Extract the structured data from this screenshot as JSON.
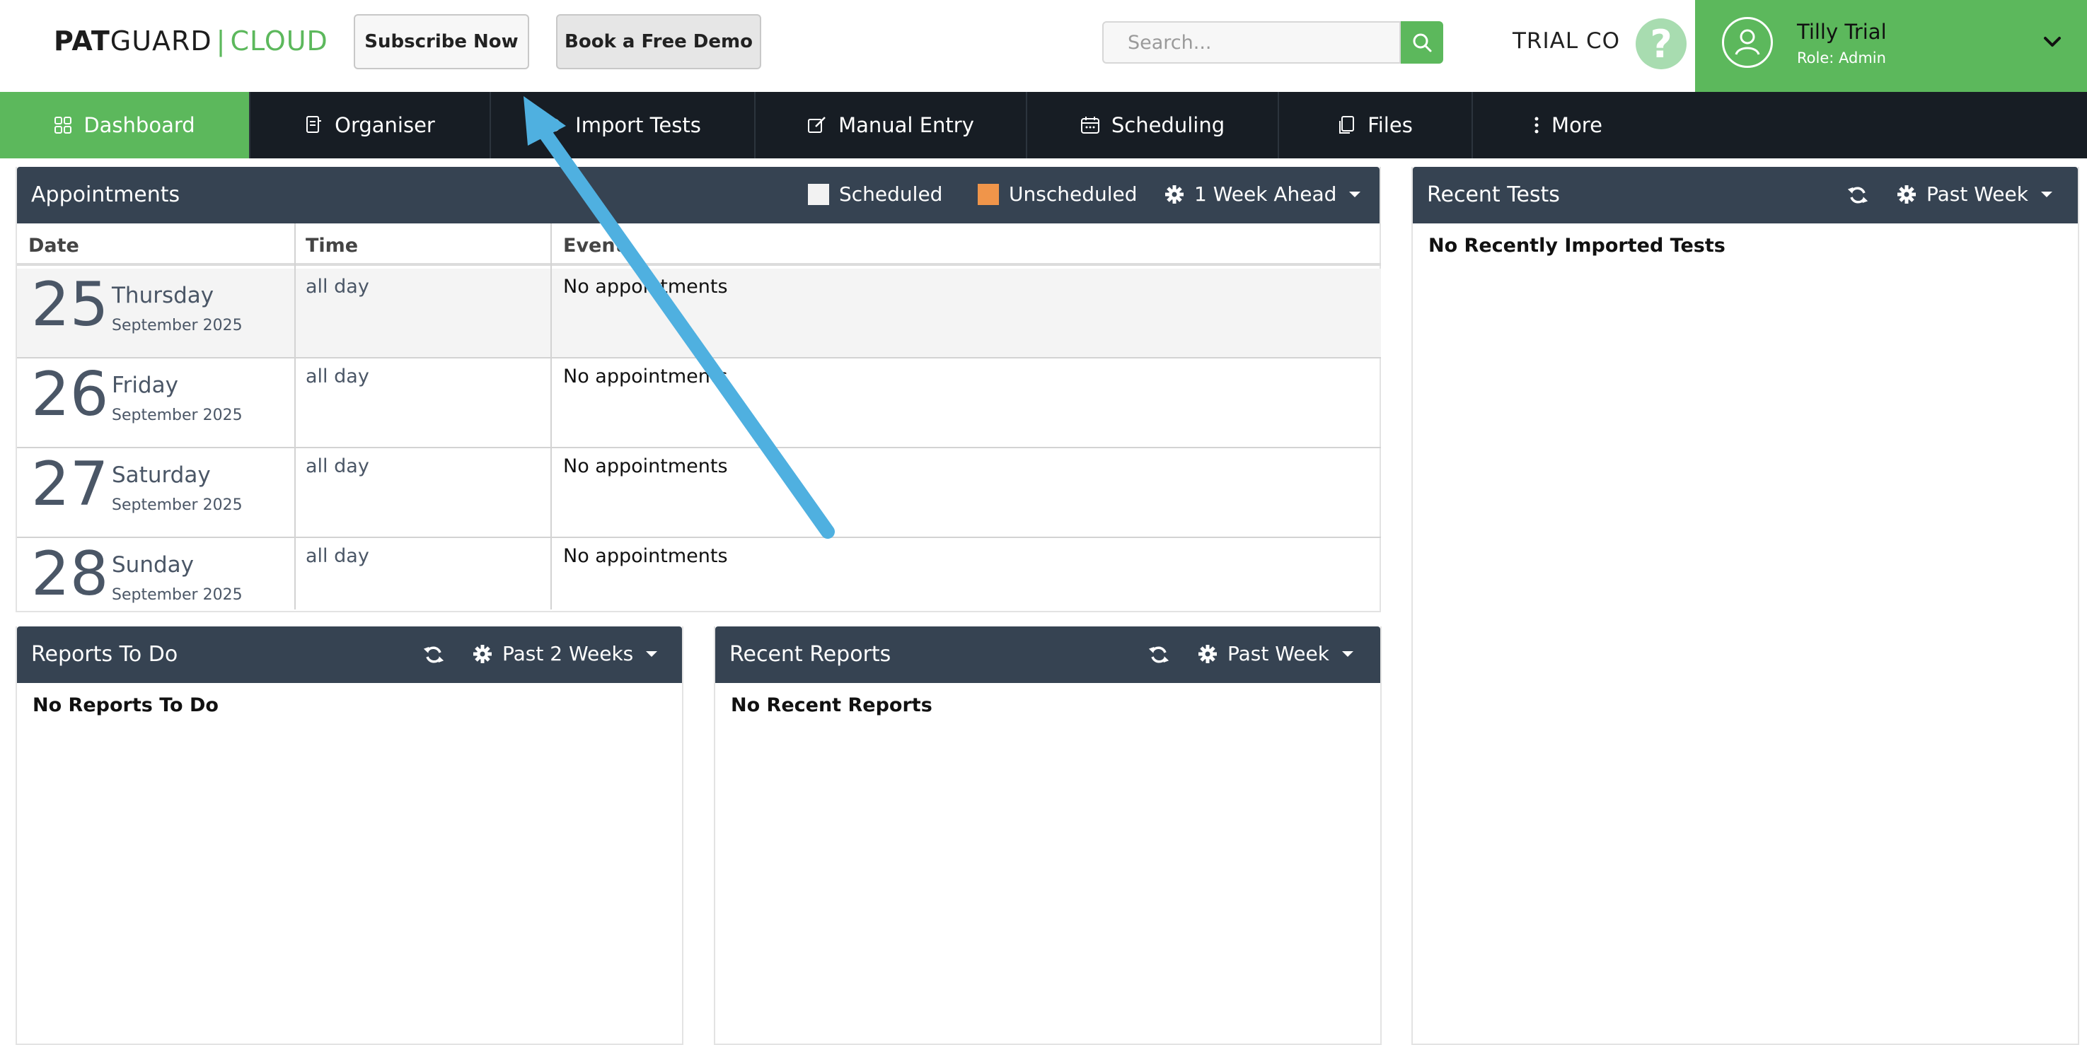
{
  "header": {
    "logo": {
      "pat": "PAT",
      "guard": "GUARD",
      "sep": "|",
      "cloud": "CLOUD"
    },
    "subscribe_label": "Subscribe Now",
    "demo_label": "Book a Free Demo",
    "search_placeholder": "Search...",
    "company": "TRIAL CO",
    "help_glyph": "?",
    "user": {
      "name": "Tilly Trial",
      "role": "Role: Admin"
    }
  },
  "nav": {
    "items": [
      {
        "label": "Dashboard",
        "icon": "grid-icon"
      },
      {
        "label": "Organiser",
        "icon": "organiser-icon"
      },
      {
        "label": "Import Tests",
        "icon": "import-icon"
      },
      {
        "label": "Manual Entry",
        "icon": "edit-icon"
      },
      {
        "label": "Scheduling",
        "icon": "calendar-icon"
      },
      {
        "label": "Files",
        "icon": "files-icon"
      },
      {
        "label": "More",
        "icon": "kebab-icon"
      }
    ]
  },
  "appointments": {
    "title": "Appointments",
    "legend_scheduled": "Scheduled",
    "legend_unscheduled": "Unscheduled",
    "range": "1 Week Ahead",
    "columns": {
      "date": "Date",
      "time": "Time",
      "event": "Event"
    },
    "rows": [
      {
        "day": "25",
        "weekday": "Thursday",
        "month": "September 2025",
        "time": "all day",
        "event": "No appointments"
      },
      {
        "day": "26",
        "weekday": "Friday",
        "month": "September 2025",
        "time": "all day",
        "event": "No appointments"
      },
      {
        "day": "27",
        "weekday": "Saturday",
        "month": "September 2025",
        "time": "all day",
        "event": "No appointments"
      },
      {
        "day": "28",
        "weekday": "Sunday",
        "month": "September 2025",
        "time": "all day",
        "event": "No appointments"
      }
    ]
  },
  "recent_tests": {
    "title": "Recent Tests",
    "range": "Past Week",
    "empty": "No Recently Imported Tests"
  },
  "reports_todo": {
    "title": "Reports To Do",
    "range": "Past 2 Weeks",
    "empty": "No Reports To Do"
  },
  "recent_reports": {
    "title": "Recent Reports",
    "range": "Past Week",
    "empty": "No Recent Reports"
  },
  "colors": {
    "brand_green": "#5cb85c",
    "nav_dark": "#171d24",
    "panel_head": "#364352",
    "unscheduled": "#f0954a",
    "arrow": "#4fb0e0"
  }
}
